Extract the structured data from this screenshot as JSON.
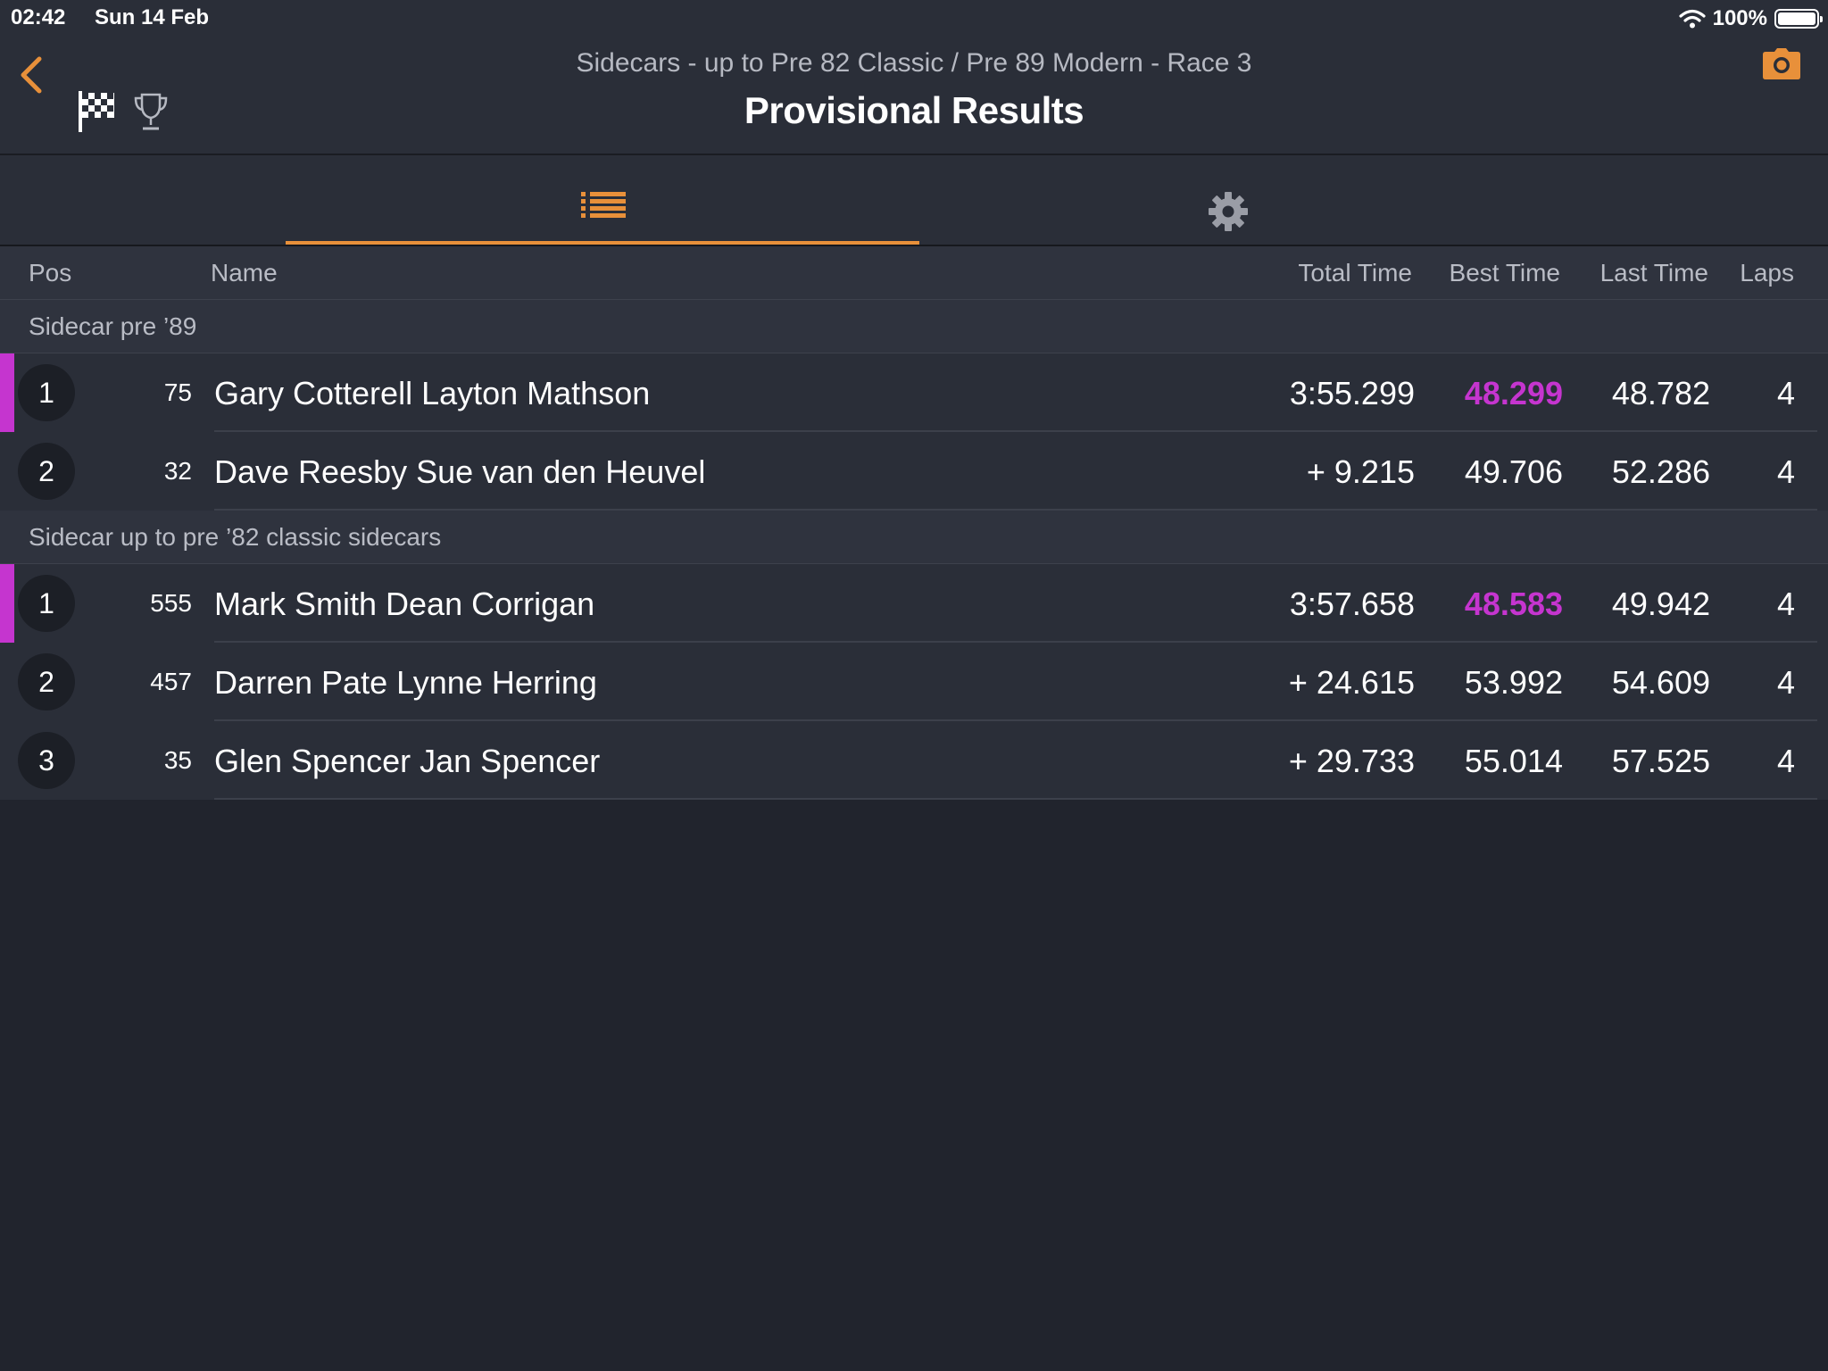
{
  "status": {
    "time": "02:42",
    "date": "Sun 14 Feb",
    "battery": "100%"
  },
  "header": {
    "subtitle": "Sidecars - up to Pre 82 Classic / Pre 89 Modern - Race 3",
    "title": "Provisional Results"
  },
  "columns": {
    "pos": "Pos",
    "name": "Name",
    "total": "Total Time",
    "best": "Best Time",
    "last": "Last Time",
    "laps": "Laps"
  },
  "groups": [
    {
      "label": "Sidecar pre ’89",
      "rows": [
        {
          "pos": "1",
          "num": "75",
          "name": "Gary Cotterell Layton Mathson",
          "total": "3:55.299",
          "best": "48.299",
          "last": "48.782",
          "laps": "4"
        },
        {
          "pos": "2",
          "num": "32",
          "name": "Dave Reesby Sue van den Heuvel",
          "total": "+ 9.215",
          "best": "49.706",
          "last": "52.286",
          "laps": "4"
        }
      ]
    },
    {
      "label": "Sidecar up to pre ’82 classic sidecars",
      "rows": [
        {
          "pos": "1",
          "num": "555",
          "name": "Mark Smith Dean Corrigan",
          "total": "3:57.658",
          "best": "48.583",
          "last": "49.942",
          "laps": "4"
        },
        {
          "pos": "2",
          "num": "457",
          "name": "Darren Pate Lynne Herring",
          "total": "+ 24.615",
          "best": "53.992",
          "last": "54.609",
          "laps": "4"
        },
        {
          "pos": "3",
          "num": "35",
          "name": "Glen Spencer Jan Spencer",
          "total": "+ 29.733",
          "best": "55.014",
          "last": "57.525",
          "laps": "4"
        }
      ]
    }
  ],
  "colors": {
    "accent": "#e8903a",
    "fastest": "#c535cf",
    "background": "#21242d"
  },
  "icons": {
    "back": "chevron-left-icon",
    "flag": "checkered-flag-icon",
    "trophy": "trophy-icon",
    "camera": "camera-icon",
    "list": "list-icon",
    "settings": "gear-icon"
  }
}
